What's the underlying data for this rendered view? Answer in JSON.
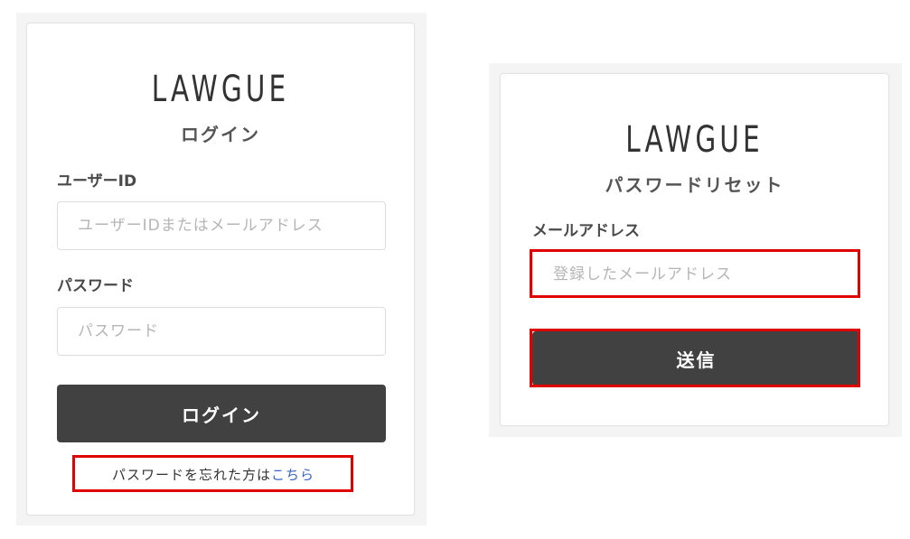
{
  "login": {
    "logo": "LAWGUE",
    "title": "ログイン",
    "user_label": "ユーザーID",
    "user_placeholder": "ユーザーIDまたはメールアドレス",
    "password_label": "パスワード",
    "password_placeholder": "パスワード",
    "submit_label": "ログイン",
    "forgot_text": "パスワードを忘れた方は",
    "forgot_link": "こちら"
  },
  "reset": {
    "logo": "LAWGUE",
    "title": "パスワードリセット",
    "email_label": "メールアドレス",
    "email_placeholder": "登録したメールアドレス",
    "submit_label": "送信"
  },
  "colors": {
    "button": "#414141",
    "highlight": "#e00000",
    "link": "#3a63c7"
  }
}
